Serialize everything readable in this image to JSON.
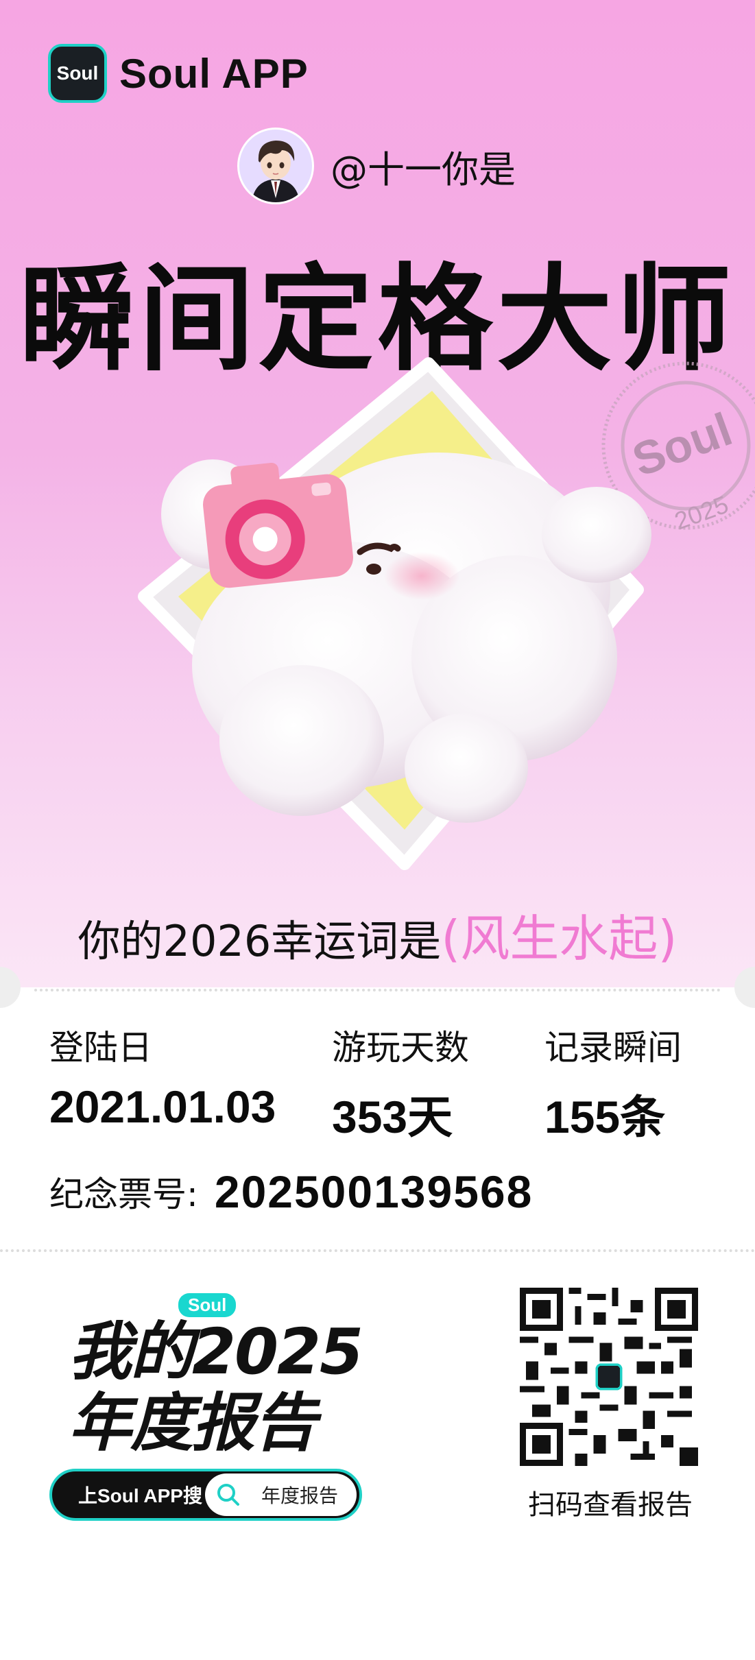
{
  "brand": {
    "badge_text": "Soul",
    "name": "Soul APP",
    "accent": "#1fd0c6"
  },
  "user": {
    "handle": "@十一你是",
    "avatar_icon": "anime-boy-avatar"
  },
  "title": "瞬间定格大师",
  "stamp_text": [
    "Soul",
    "2025"
  ],
  "lucky": {
    "prefix": "你的2026幸运词是",
    "word": "(风生水起)"
  },
  "stats": [
    {
      "label": "登陆日",
      "value": "2021.01.03"
    },
    {
      "label": "游玩天数",
      "value": "353天"
    },
    {
      "label": "记录瞬间",
      "value": "155条"
    }
  ],
  "ticket": {
    "label": "纪念票号:",
    "number": "202500139568"
  },
  "report": {
    "pill": "Soul",
    "line1": "我的2025",
    "line2": "年度报告"
  },
  "search_bar": {
    "prefix": "上Soul APP搜",
    "keyword": "年度报告",
    "icon": "search-icon"
  },
  "qr": {
    "label": "扫码查看报告",
    "icon": "qr-code"
  },
  "colors": {
    "hero_pink": "#f6a6e3",
    "lucky_pink": "#f07bd2"
  }
}
